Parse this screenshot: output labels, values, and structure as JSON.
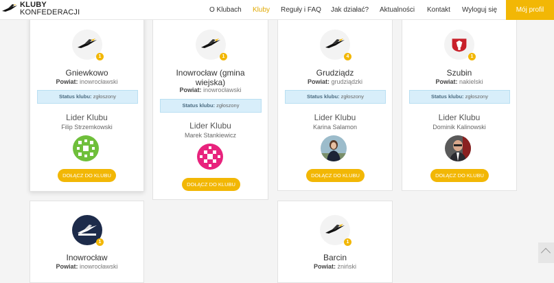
{
  "brand": {
    "line1": "KLUBY",
    "line2": "KONFEDERACJI"
  },
  "nav": {
    "items": [
      "O Klubach",
      "Kluby",
      "Reguły i FAQ",
      "Jak działać?",
      "Aktualności",
      "Kontakt",
      "Wyloguj się"
    ],
    "active": "Kluby"
  },
  "profile_button": "Mój profil",
  "labels": {
    "powiat": "Powiat:",
    "status_label": "Status klubu:",
    "lider": "Lider Klubu",
    "join": "DOŁĄCZ DO KLUBU"
  },
  "clubs": [
    {
      "name": "Gniewkowo",
      "powiat": "inowrocławski",
      "status": "zgłoszony",
      "lider": "Filip Strzemkowski",
      "badge": "1"
    },
    {
      "name": "Inowrocław (gmina wiejska)",
      "powiat": "inowrocławski",
      "status": "zgłoszony",
      "lider": "Marek Stankiewicz",
      "badge": "1"
    },
    {
      "name": "Grudziądz",
      "powiat": "grudziądzki",
      "status": "zgłoszony",
      "lider": "Karina Salamon",
      "badge": "4"
    },
    {
      "name": "Szubin",
      "powiat": "nakielski",
      "status": "zgłoszony",
      "lider": "Dominik Kalinowski",
      "badge": "1"
    },
    {
      "name": "Inowrocław",
      "powiat": "inowrocławski",
      "badge": "1"
    },
    {
      "name": "Barcin",
      "powiat": "żniński",
      "badge": "1"
    }
  ],
  "colors": {
    "accent": "#f2b705",
    "status_bg": "#d8eefa"
  }
}
